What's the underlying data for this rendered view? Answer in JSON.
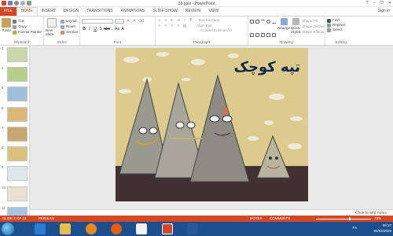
{
  "window": {
    "title": "33.pptx - PowerPoint",
    "controls": [
      "?",
      "–",
      "❐",
      "✕"
    ]
  },
  "tabs": [
    "FILE",
    "HOME",
    "INSERT",
    "DESIGN",
    "TRANSITIONS",
    "ANIMATIONS",
    "SLIDE SHOW",
    "REVIEW",
    "VIEW"
  ],
  "signin": "Sign in",
  "ribbon": {
    "clipboard": {
      "paste": "Paste",
      "cut": "Cut",
      "copy": "Copy",
      "format_painter": "Format Painter",
      "label": "Clipboard"
    },
    "slides": {
      "new_slide": "New Slide",
      "layout": "Layout",
      "reset": "Reset",
      "section": "Section",
      "label": "Slides"
    },
    "font": {
      "label": "Font"
    },
    "paragraph": {
      "text_direction": "Text Direction",
      "align_text": "Align Text",
      "convert_smartart": "Convert to SmartArt",
      "label": "Paragraph"
    },
    "drawing": {
      "arrange": "Arrange",
      "quick_styles": "Quick Styles",
      "shape_fill": "Shape Fill",
      "shape_outline": "Shape Outline",
      "shape_effects": "Shape Effects",
      "label": "Drawing"
    },
    "editing": {
      "find": "Find",
      "replace": "Replace",
      "select": "Select",
      "label": "Editing"
    }
  },
  "thumbnails": [
    "3",
    "4",
    "5",
    "6",
    "7",
    "8",
    "9",
    "10",
    "11"
  ],
  "slide": {
    "title": "تپه کوچک"
  },
  "notes_placeholder": "Click to add notes",
  "status": {
    "slide_info": "SLIDE 2 OF 16",
    "language": "PERSIAN",
    "notes": "NOTES",
    "comments": "COMMENTS",
    "zoom": "78%",
    "zoom_fraction": 0.6
  },
  "taskbar": {
    "tray_lang": "FA",
    "time": "06:17",
    "date": "04/02/2022"
  },
  "colors": {
    "accent": "#d24726",
    "slide_bg": "#d9c98a",
    "title_color": "#12264f",
    "taskbar": "#1d4f8f"
  }
}
